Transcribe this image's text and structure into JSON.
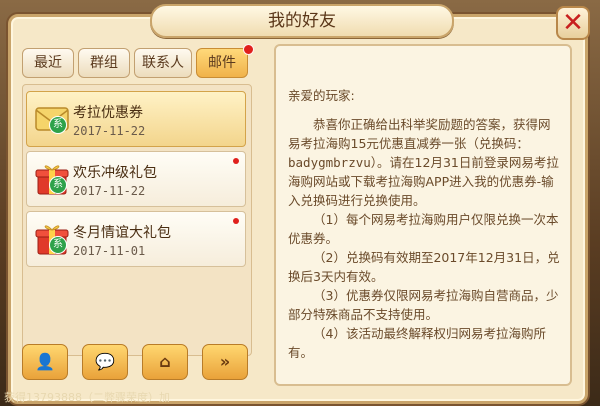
{
  "window": {
    "title": "我的好友"
  },
  "colors": {
    "accent": "#f0b24a",
    "notify_dot": "#e0201c",
    "system_badge": "#2ea24a"
  },
  "tabs": [
    {
      "label": "最近",
      "active": false
    },
    {
      "label": "群组",
      "active": false
    },
    {
      "label": "联系人",
      "active": false
    },
    {
      "label": "邮件",
      "active": true
    }
  ],
  "mails": [
    {
      "title": "考拉优惠券",
      "date": "2017-11-22",
      "icon": "envelope-icon",
      "badge": "系",
      "selected": true,
      "unread": false
    },
    {
      "title": "欢乐冲级礼包",
      "date": "2017-11-22",
      "icon": "gift-icon",
      "badge": "系",
      "selected": false,
      "unread": true
    },
    {
      "title": "冬月情谊大礼包",
      "date": "2017-11-01",
      "icon": "gift-icon",
      "badge": "系",
      "selected": false,
      "unread": true
    }
  ],
  "bottom_buttons": [
    {
      "icon": "add-friend-icon",
      "glyph": "👤"
    },
    {
      "icon": "chat-icon",
      "glyph": "💬"
    },
    {
      "icon": "home-icon",
      "glyph": "⌂"
    },
    {
      "icon": "next-icon",
      "glyph": "»"
    }
  ],
  "content": {
    "greeting": "亲爱的玩家:",
    "body_1a": "恭喜你正确给出科举奖励题的答案，获得网易考拉海购15元优惠直减券一张（兑换码：",
    "code": "badygmbrzvu",
    "body_1b": "）。请在12月31日前登录网易考拉海购网站或下载考拉海购APP进入我的优惠券-输入兑换码进行兑换使用。",
    "rule_1": "（1）每个网易考拉海购用户仅限兑换一次本优惠券。",
    "rule_2": "（2）兑换码有效期至2017年12月31日，兑换后3天内有效。",
    "rule_3": "（3）优惠券仅限网易考拉海购自营商品，少部分特殊商品不支持使用。",
    "rule_4": "（4）该活动最终解释权归网易考拉海购所有。"
  },
  "chat_bar": {
    "text": "获得13793888（二弊骤荣度）加"
  }
}
